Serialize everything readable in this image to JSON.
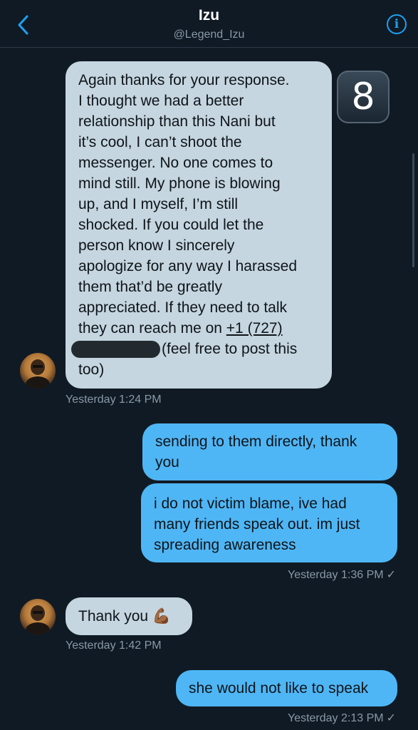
{
  "header": {
    "back_icon": "chevron-left-icon",
    "name": "Izu",
    "handle": "@Legend_Izu",
    "info_icon": "info-icon",
    "info_glyph": "i"
  },
  "badge": {
    "glyph": "8",
    "icon": "keycap-eight-icon"
  },
  "messages": [
    {
      "direction": "incoming",
      "lines": [
        "Again thanks for your response.",
        "I thought we had a better",
        "relationship than this Nani but",
        "it’s cool, I can’t shoot the",
        "messenger. No one comes to",
        "mind still. My phone is blowing",
        "up, and I myself, I’m still",
        "shocked. If you could let the",
        "person know I sincerely",
        "apologize for any way I harassed",
        "them that’d be greatly",
        "appreciated. If they need to talk",
        "they can reach me on "
      ],
      "phone": "+1 (727)",
      "tail": "(feel free to post this",
      "last": "too)",
      "timestamp": "Yesterday 1:24 PM"
    },
    {
      "direction": "outgoing",
      "lines": [
        "sending to them directly, thank",
        "you"
      ]
    },
    {
      "direction": "outgoing",
      "lines": [
        "i do not victim blame, ive had",
        "many friends speak out. im just",
        "spreading awareness"
      ],
      "timestamp": "Yesterday 1:36 PM",
      "check": "✓"
    },
    {
      "direction": "incoming",
      "lines": [
        "Thank you "
      ],
      "emoji": "💪🏾",
      "timestamp": "Yesterday 1:42 PM"
    },
    {
      "direction": "outgoing",
      "lines": [
        "she would not like to speak"
      ],
      "timestamp": "Yesterday 2:13 PM",
      "check": "✓"
    }
  ]
}
